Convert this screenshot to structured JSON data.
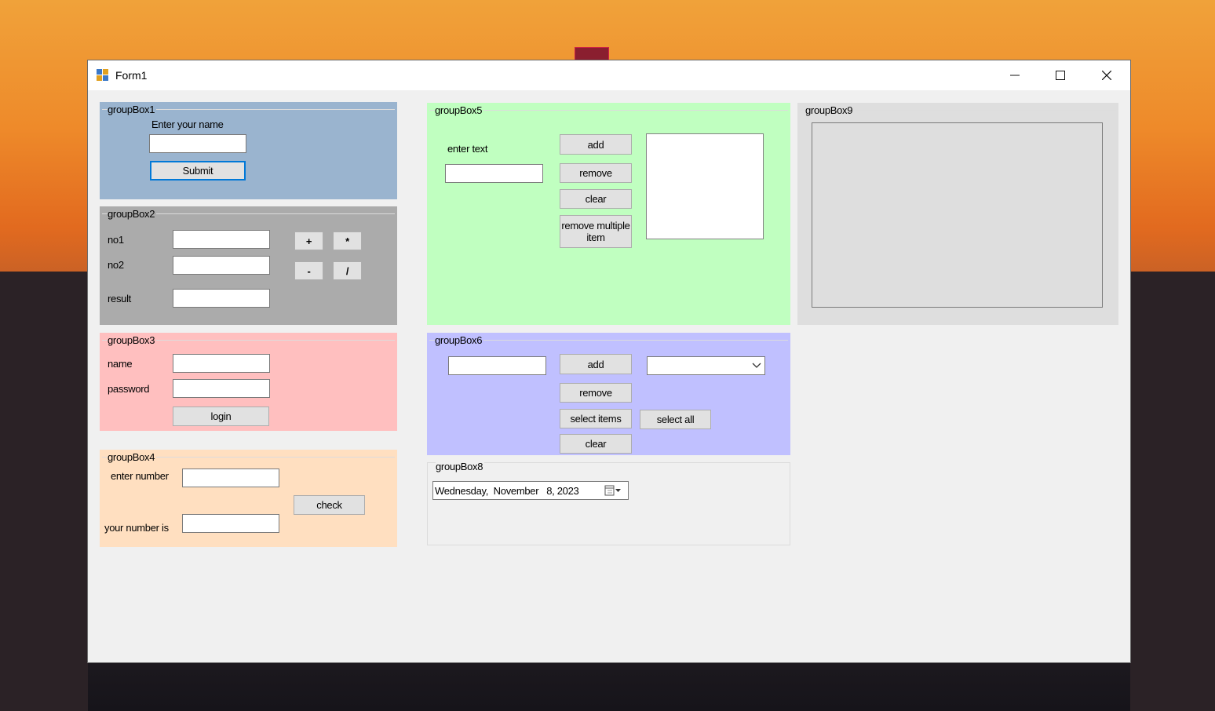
{
  "window": {
    "title": "Form1"
  },
  "group1": {
    "legend": "groupBox1",
    "prompt_label": "Enter your name",
    "name_value": "",
    "submit_label": "Submit",
    "color": "#9ab4cf"
  },
  "group2": {
    "legend": "groupBox2",
    "no1_label": "no1",
    "no2_label": "no2",
    "result_label": "result",
    "plus_label": "+",
    "mul_label": "*",
    "minus_label": "-",
    "div_label": "/",
    "color": "#ababab"
  },
  "group3": {
    "legend": "groupBox3",
    "name_label": "name",
    "password_label": "password",
    "login_label": "login",
    "color": "#ffbfbf"
  },
  "group4": {
    "legend": "groupBox4",
    "enter_label": "enter number",
    "check_label": "check",
    "your_label": "your number is",
    "color": "#ffdfc0"
  },
  "group5": {
    "legend": "groupBox5",
    "enter_text_label": "enter text",
    "add_label": "add",
    "remove_label": "remove",
    "clear_label": "clear",
    "remove_multi_label": "remove multiple item",
    "color": "#c0ffc0"
  },
  "group6": {
    "legend": "groupBox6",
    "add_label": "add",
    "remove_label": "remove",
    "select_items_label": "select items",
    "select_all_label": "select all",
    "clear_label": "clear",
    "color": "#c0c0ff"
  },
  "group8": {
    "legend": "groupBox8",
    "date_value": "Wednesday,  November   8, 2023"
  },
  "group9": {
    "legend": "groupBox9",
    "color": "#dedede"
  },
  "icons": {
    "minimize": "minimize-icon",
    "maximize": "maximize-icon",
    "close": "close-icon",
    "app": "app-icon",
    "dropdown": "chevron-down-icon",
    "calendar": "calendar-icon"
  }
}
